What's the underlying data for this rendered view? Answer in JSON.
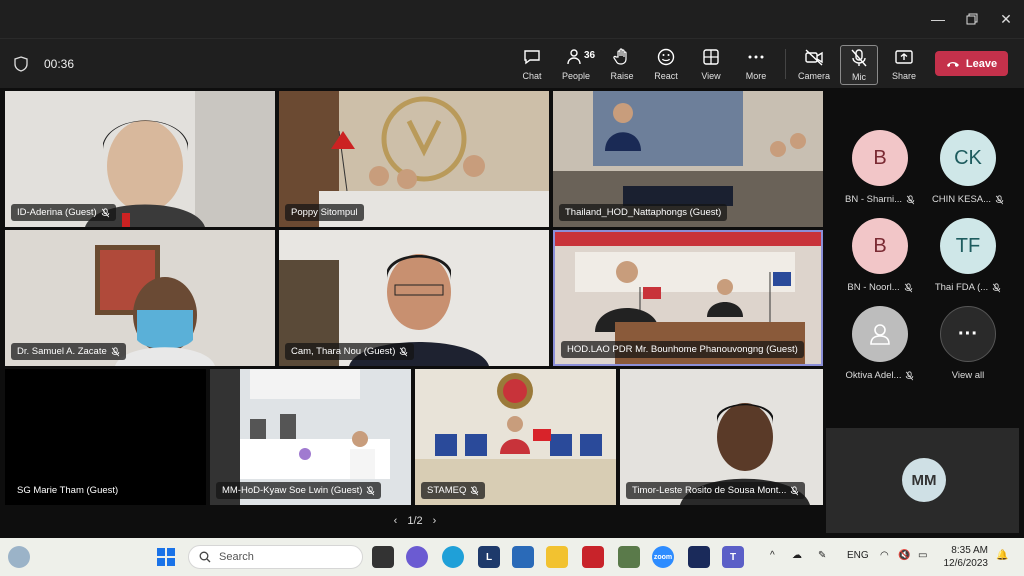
{
  "call": {
    "timer": "00:36",
    "people_count": "36",
    "toolbar": {
      "chat": "Chat",
      "people": "People",
      "raise": "Raise",
      "react": "React",
      "view": "View",
      "more": "More",
      "camera": "Camera",
      "mic": "Mic",
      "share": "Share",
      "leave": "Leave"
    },
    "pager": "1/2"
  },
  "tiles": [
    {
      "name": "ID-Aderina (Guest)"
    },
    {
      "name": "Poppy Sitompul"
    },
    {
      "name": "Thailand_HOD_Nattaphongs (Guest)"
    },
    {
      "name": "Dr. Samuel A. Zacate"
    },
    {
      "name": "Cam, Thara Nou (Guest)"
    },
    {
      "name": "HOD.LAO PDR Mr. Bounhome Phanouvongng (Guest)"
    },
    {
      "name": "SG Marie Tham (Guest)"
    },
    {
      "name": "MM-HoD-Kyaw Soe Lwin (Guest)"
    },
    {
      "name": "STAMEQ"
    },
    {
      "name": "Timor-Leste Rosito de Sousa Mont..."
    }
  ],
  "sidebar": [
    {
      "initials": "B",
      "name": "BN - Sharni...",
      "color": "#f2c6c8",
      "text_color": "#7a2a33"
    },
    {
      "initials": "CK",
      "name": "CHIN KESA...",
      "color": "#cfe7e8",
      "text_color": "#1e5c5e"
    },
    {
      "initials": "B",
      "name": "BN - Noorl...",
      "color": "#f2c6c8",
      "text_color": "#7a2a33"
    },
    {
      "initials": "TF",
      "name": "Thai FDA (...",
      "color": "#cfe7e8",
      "text_color": "#1e5c5e"
    },
    {
      "initials": "",
      "name": "Oktiva Adel...",
      "color": "#bdbdbd",
      "text_color": "#444"
    },
    {
      "initials": "···",
      "name": "View all",
      "color": "#2a2a2a",
      "text_color": "#fff"
    }
  ],
  "self_view": {
    "initials": "MM"
  },
  "taskbar": {
    "search_placeholder": "Search",
    "lang": "ENG",
    "time": "8:35 AM",
    "date": "12/6/2023"
  }
}
